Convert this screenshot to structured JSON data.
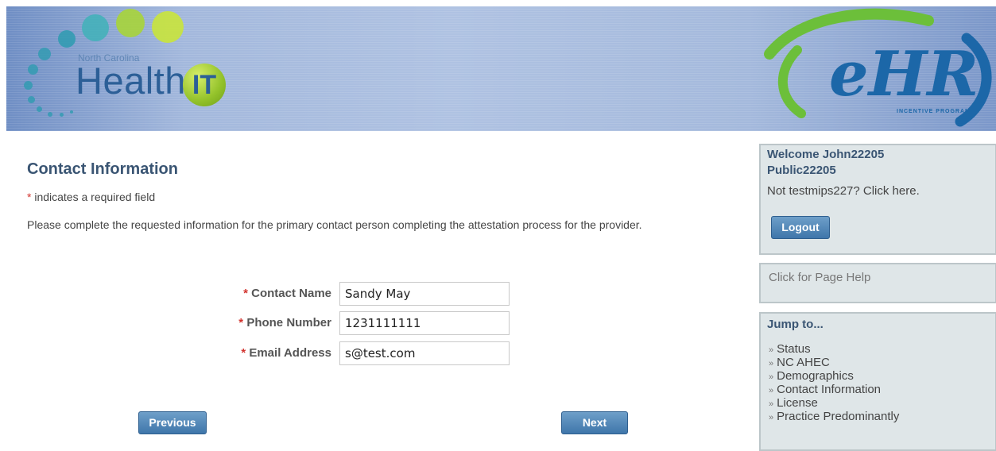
{
  "header": {
    "nc_text": "North Carolina",
    "health_text": "Health",
    "it_text": "IT",
    "ehr_text": "eHR",
    "ehr_sub": "INCENTIVE PROGRAM"
  },
  "main": {
    "title": "Contact Information",
    "required_star": "*",
    "required_note": " indicates a required field",
    "instructions": "Please complete the requested information for the primary contact person completing the attestation process for the provider.",
    "fields": [
      {
        "star": "*",
        "label": "Contact Name",
        "value": "Sandy May"
      },
      {
        "star": "*",
        "label": "Phone Number",
        "value": "1231111111"
      },
      {
        "star": "*",
        "label": "Email Address",
        "value": "s@test.com"
      }
    ],
    "previous_label": "Previous",
    "next_label": "Next"
  },
  "sidebar": {
    "welcome_line1": "Welcome John22205",
    "welcome_line2": "Public22205",
    "not_user": "Not testmips227? Click here.",
    "logout_label": "Logout",
    "page_help": "Click for Page Help",
    "jump_title": "Jump to...",
    "jump_items": [
      {
        "label": "Status"
      },
      {
        "label": "NC AHEC"
      },
      {
        "label": "Demographics"
      },
      {
        "label": "Contact Information"
      },
      {
        "label": "License"
      },
      {
        "label": "Practice Predominantly"
      }
    ]
  },
  "colors": {
    "accent": "#3a5573",
    "button": "#3f76aa",
    "required": "#d2332e",
    "panel": "#dfe6e8"
  }
}
